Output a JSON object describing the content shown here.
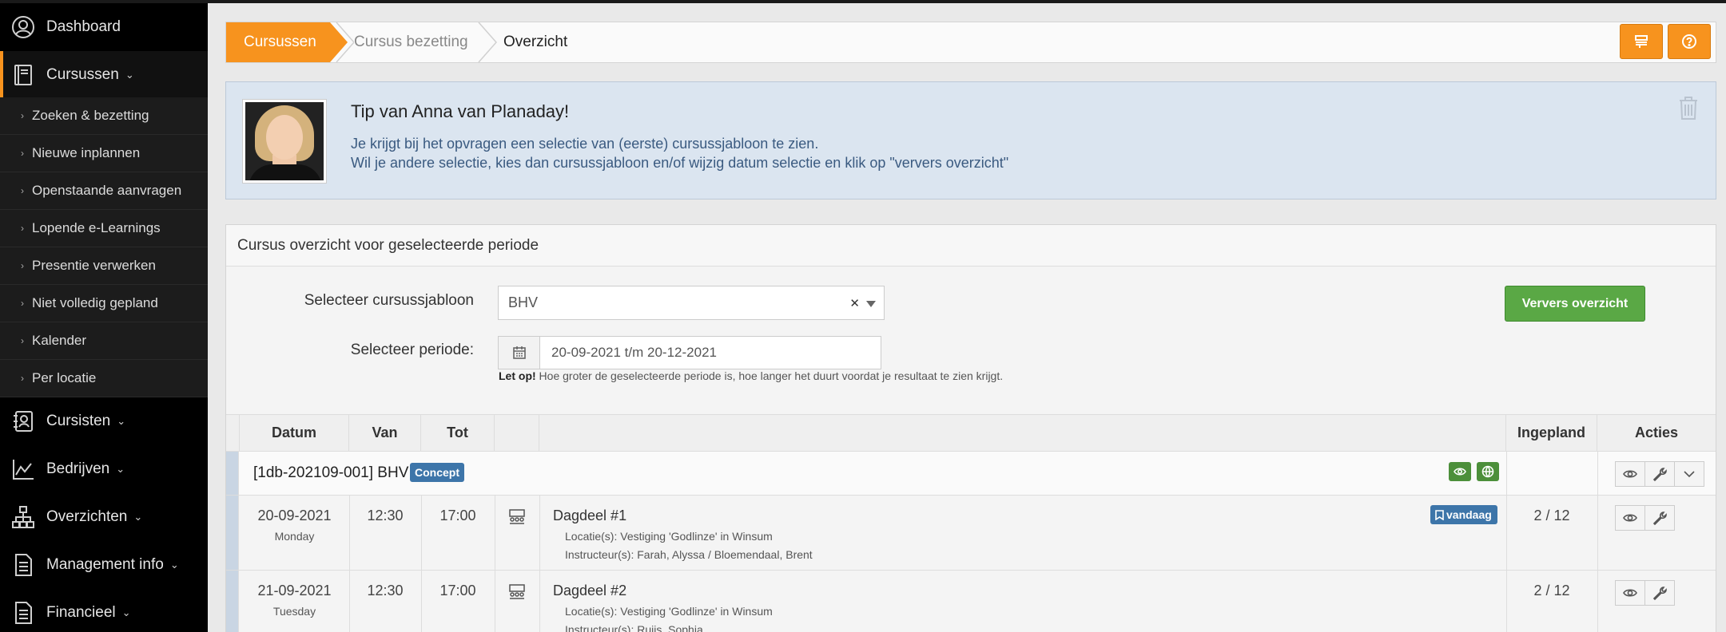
{
  "sidebar": {
    "items": [
      {
        "label": "Dashboard",
        "icon": "user-circle-icon"
      },
      {
        "label": "Cursussen",
        "icon": "book-icon"
      },
      {
        "label": "Cursisten",
        "icon": "person-card-icon"
      },
      {
        "label": "Bedrijven",
        "icon": "chart-icon"
      },
      {
        "label": "Overzichten",
        "icon": "sitemap-icon"
      },
      {
        "label": "Management info",
        "icon": "document-icon"
      },
      {
        "label": "Financieel",
        "icon": "document-icon"
      }
    ],
    "subitems": [
      "Zoeken & bezetting",
      "Nieuwe inplannen",
      "Openstaande aanvragen",
      "Lopende e-Learnings",
      "Presentie verwerken",
      "Niet volledig gepland",
      "Kalender",
      "Per locatie"
    ]
  },
  "breadcrumb": {
    "items": [
      "Cursussen",
      "Cursus bezetting",
      "Overzicht"
    ]
  },
  "tip": {
    "title": "Tip van Anna van Planaday!",
    "line1": "Je krijgt bij het opvragen een selectie van (eerste) cursussjabloon te zien.",
    "line2": "Wil je andere selectie, kies dan cursussjabloon en/of wijzig datum selectie en klik op \"ververs overzicht\""
  },
  "panel": {
    "title": "Cursus overzicht voor geselecteerde periode",
    "template_label": "Selecteer cursussjabloon",
    "template_value": "BHV",
    "period_label": "Selecteer periode:",
    "period_value": "20-09-2021 t/m 20-12-2021",
    "warning_bold": "Let op!",
    "warning_text": " Hoe groter de geselecteerde periode is, hoe langer het duurt voordat je resultaat te zien krijgt.",
    "refresh_button": "Ververs overzicht"
  },
  "table": {
    "headers": {
      "datum": "Datum",
      "van": "Van",
      "tot": "Tot",
      "icon": "",
      "desc": "",
      "ingepland": "Ingepland",
      "acties": "Acties"
    },
    "group": {
      "title": "[1db-202109-001] BHV",
      "badge": "Concept"
    },
    "rows": [
      {
        "date": "20-09-2021",
        "day": "Monday",
        "from": "12:30",
        "to": "17:00",
        "title": "Dagdeel #1",
        "location": "Locatie(s): Vestiging 'Godlinze' in Winsum",
        "instructor": "Instructeur(s): Farah, Alyssa / Bloemendaal, Brent",
        "badge": "vandaag",
        "planned": "2 / 12"
      },
      {
        "date": "21-09-2021",
        "day": "Tuesday",
        "from": "12:30",
        "to": "17:00",
        "title": "Dagdeel #2",
        "location": "Locatie(s): Vestiging 'Godlinze' in Winsum",
        "instructor": "Instructeur(s): Ruijs, Sophia",
        "badge": "",
        "planned": "2 / 12"
      }
    ]
  },
  "colors": {
    "accent": "#f7931e",
    "primary": "#3d75a9",
    "success": "#5aa845",
    "sidebar": "#000000"
  }
}
